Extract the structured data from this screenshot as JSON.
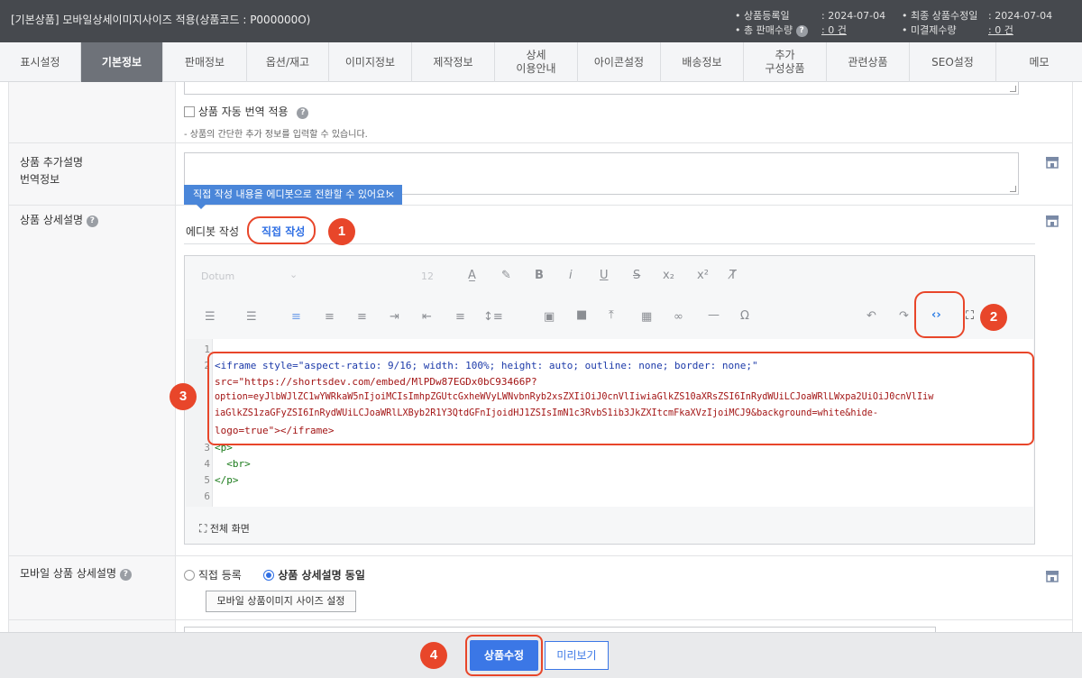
{
  "header": {
    "title": "[기본상품] 모바일상세이미지사이즈 적용(상품코드 : P000000O)",
    "reg_date_label": "• 상품등록일",
    "reg_date_value": ": 2024-07-04",
    "sales_label": "• 총 판매수량",
    "sales_value": ": 0 건",
    "mod_date_label": "• 최종 상품수정일",
    "mod_date_value": ": 2024-07-04",
    "unpaid_label": "• 미결제수량",
    "unpaid_value": ": 0 건"
  },
  "tabs": [
    {
      "label": "표시설정",
      "active": false
    },
    {
      "label": "기본정보",
      "active": true
    },
    {
      "label": "판매정보",
      "active": false
    },
    {
      "label": "옵션/재고",
      "active": false
    },
    {
      "label": "이미지정보",
      "active": false
    },
    {
      "label": "제작정보",
      "active": false
    },
    {
      "label": "상세\n이용안내",
      "active": false
    },
    {
      "label": "아이콘설정",
      "active": false
    },
    {
      "label": "배송정보",
      "active": false
    },
    {
      "label": "추가\n구성상품",
      "active": false
    },
    {
      "label": "관련상품",
      "active": false
    },
    {
      "label": "SEO설정",
      "active": false
    },
    {
      "label": "메모",
      "active": false
    }
  ],
  "form": {
    "auto_translate_label": "상품 자동 번역 적용",
    "short_desc_hint": "- 상품의 간단한 추가 정보를 입력할 수 있습니다.",
    "extra_desc_label_1": "상품 추가설명",
    "extra_desc_label_2": "번역정보",
    "detail_label": "상품 상세설명",
    "tooltip": "직접 작성 내용을 에디봇으로 전환할 수 있어요!",
    "tooltip_close": "×",
    "mode_editbot": "에디봇 작성",
    "mode_direct": "직접 작성",
    "mobile_label": "모바일 상품 상세설명",
    "mobile_opt_direct": "직접 등록",
    "mobile_opt_same": "상품 상세설명 동일",
    "mobile_size_btn": "모바일 상품이미지 사이즈 설정"
  },
  "editor": {
    "font_placeholder": "Dotum",
    "size_placeholder": "12",
    "fullscreen_label": "전체 화면",
    "code_lines": [
      {
        "n": "1",
        "text": ""
      },
      {
        "n": "2",
        "text": "<iframe style=\"aspect-ratio: 9/16; width: 100%; height: auto; outline: none; border: none;\""
      },
      {
        "n": "",
        "text": "src=\"https://shortsdev.com/embed/MlPDw87EGDx0bC93466P?"
      },
      {
        "n": "",
        "text": "option=eyJlbWJlZC1wYWRkaW5nIjoiMCIsImhpZGUtcGxheWVyLWNvbnRyb2xsZXIiOiJ0cnVlIiwiaGlkZS10aXRsZSI6InRydWUiLCJoaWRlLWxpa2UiOiJ0cnVlIiw"
      },
      {
        "n": "",
        "text": "iaGlkZS1zaGFyZSI6InRydWUiLCJoaWRlLXByb2R1Y3QtdGFnIjoidHJ1ZSIsImN1c3RvbS1ib3JkZXItcmFkaXVzIjoiMCJ9&background=white&hide-"
      },
      {
        "n": "",
        "text": "logo=true\"></iframe>"
      },
      {
        "n": "3",
        "text": "<p>"
      },
      {
        "n": "4",
        "text": "  <br>"
      },
      {
        "n": "5",
        "text": "</p>"
      },
      {
        "n": "6",
        "text": ""
      }
    ]
  },
  "markers": [
    "1",
    "2",
    "3",
    "4"
  ],
  "bottom": {
    "save_label": "상품수정",
    "preview_label": "미리보기"
  },
  "colors": {
    "accent": "#3b77e6",
    "highlight": "#e8462a",
    "header_bg": "#46494e",
    "tooltip_bg": "#4a86d9"
  }
}
